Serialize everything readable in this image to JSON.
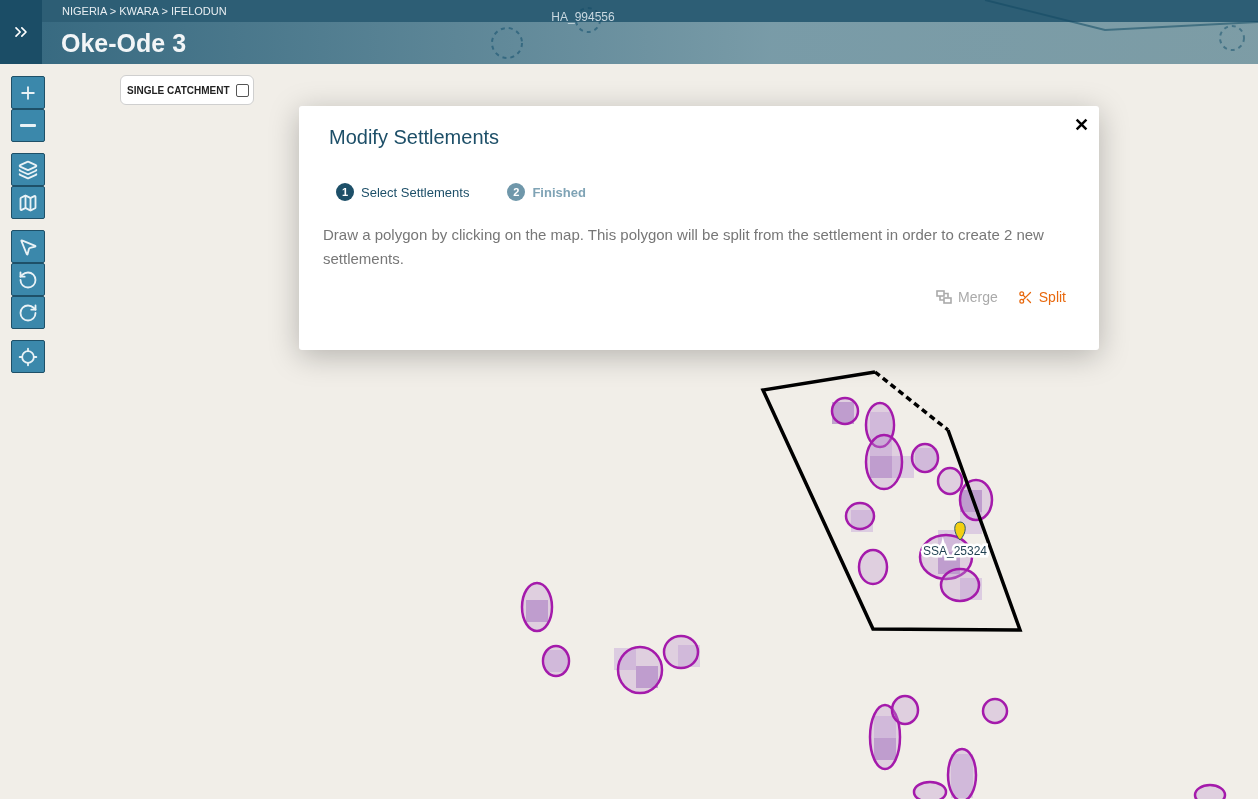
{
  "header": {
    "breadcrumb": "NIGERIA > KWARA > IFELODUN",
    "title": "Oke-Ode 3"
  },
  "map_labels": [
    {
      "text": "HA_994556"
    },
    {
      "text": "SSA_25324"
    }
  ],
  "toolbar": [
    [
      {
        "kind": "zoom-in"
      },
      {
        "kind": "zoom-out"
      }
    ],
    [
      {
        "kind": "layers"
      },
      {
        "kind": "map"
      }
    ],
    [
      {
        "kind": "select"
      },
      {
        "kind": "undo"
      },
      {
        "kind": "redo"
      }
    ],
    [
      {
        "kind": "locate"
      }
    ]
  ],
  "single_catchment": {
    "label": "SINGLE CATCHMENT",
    "checked": false
  },
  "dialog": {
    "title": "Modify Settlements",
    "close": "✕",
    "steps": [
      {
        "number": "1",
        "label": "Select Settlements",
        "selected": true
      },
      {
        "number": "2",
        "label": "Finished",
        "selected": false
      }
    ],
    "message": "Draw a polygon by clicking on the map. This polygon will be split from the settlement in order to create 2 new settlements.",
    "actions": [
      {
        "kind": "merge",
        "label": "Merge",
        "disabled": true
      },
      {
        "kind": "split",
        "label": "Split",
        "disabled": false
      }
    ]
  }
}
